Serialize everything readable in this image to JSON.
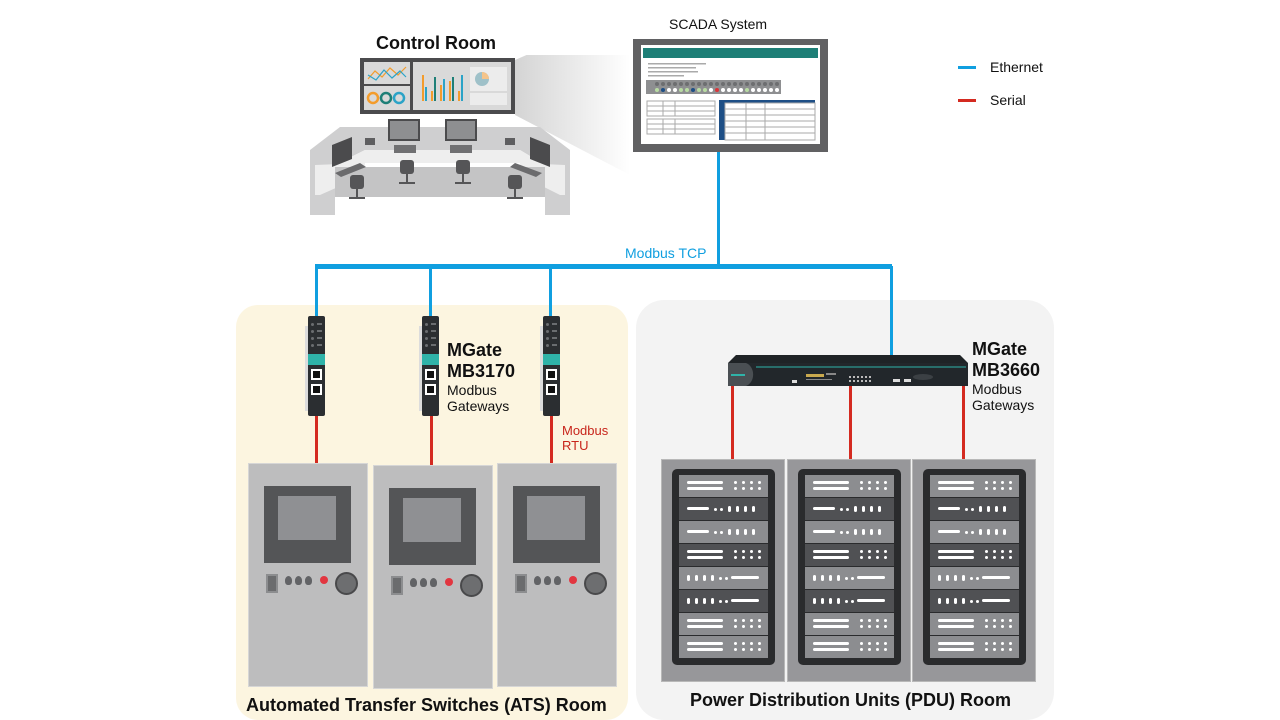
{
  "diagram": {
    "control_room": {
      "title": "Control Room"
    },
    "scada": {
      "title": "SCADA System"
    },
    "legend": {
      "items": [
        {
          "label": "Ethernet",
          "color": "#109fe0"
        },
        {
          "label": "Serial",
          "color": "#d42a20"
        }
      ]
    },
    "network": {
      "ethernet_label": "Modbus TCP",
      "serial_label_line1": "Modbus",
      "serial_label_line2": "RTU"
    },
    "gateway_mb3170": {
      "name_line1": "MGate",
      "name_line2": "MB3170",
      "desc_line1": "Modbus",
      "desc_line2": "Gateways",
      "count": 3
    },
    "gateway_mb3660": {
      "name_line1": "MGate",
      "name_line2": "MB3660",
      "desc_line1": "Modbus",
      "desc_line2": "Gateways",
      "count": 1
    },
    "ats_room": {
      "title": "Automated Transfer Switches (ATS) Room",
      "cabinet_count": 3
    },
    "pdu_room": {
      "title": "Power Distribution Units (PDU) Room",
      "rack_count": 3
    },
    "colors": {
      "ethernet": "#109fe0",
      "serial": "#d42a20",
      "ats_room_bg": "#fcf5e0",
      "pdu_room_bg": "#f3f3f3",
      "scada_header": "#1e7f77",
      "gateway_accent": "#2fb3a9"
    }
  }
}
